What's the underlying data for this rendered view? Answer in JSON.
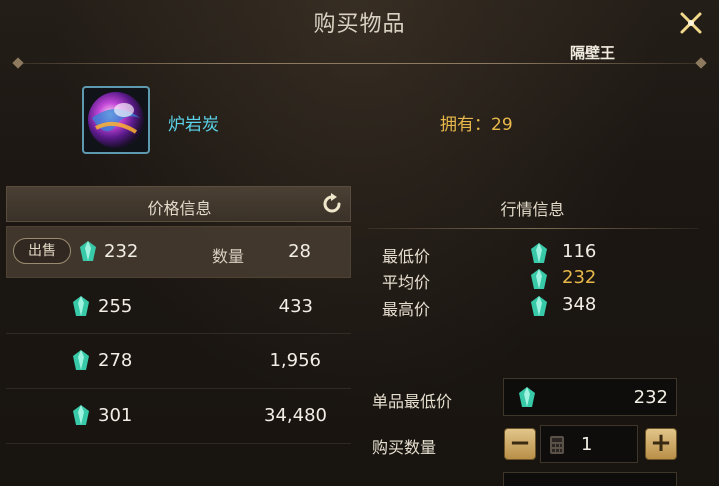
{
  "window": {
    "title": "购买物品",
    "server_name": "隔壁王"
  },
  "item": {
    "name": "炉岩炭",
    "owned_label": "拥有：29"
  },
  "price_info": {
    "header": "价格信息",
    "sell_badge": "出售",
    "quantity_label": "数量",
    "rows": [
      {
        "price": "232",
        "quantity": "28"
      },
      {
        "price": "255",
        "quantity": "433"
      },
      {
        "price": "278",
        "quantity": "1,956"
      },
      {
        "price": "301",
        "quantity": "34,480"
      }
    ]
  },
  "market_info": {
    "header": "行情信息",
    "lowest_label": "最低价",
    "lowest": "116",
    "average_label": "平均价",
    "average": "232",
    "highest_label": "最高价",
    "highest": "348"
  },
  "purchase": {
    "unit_min_label": "单品最低价",
    "unit_min_value": "232",
    "quantity_label": "购买数量",
    "quantity_value": "1",
    "minus": "−",
    "plus": "+"
  },
  "colors": {
    "accent_cyan": "#5ad4ea",
    "gold": "#e8b84a",
    "gem": "#37c9a8"
  }
}
